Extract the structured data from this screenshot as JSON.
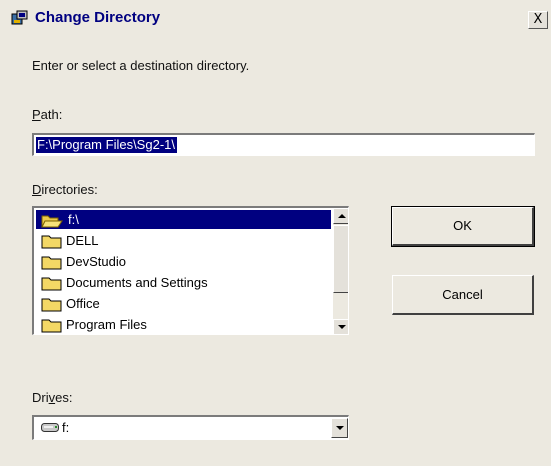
{
  "dialog": {
    "title": "Change Directory",
    "close_label": "X",
    "instruction": "Enter or select a destination directory.",
    "path_label": {
      "prefix": "",
      "accel": "P",
      "rest": "ath:"
    },
    "path_value": "F:\\Program Files\\Sg2-1\\",
    "directories_label": {
      "prefix": "",
      "accel": "D",
      "rest": "irectories:"
    },
    "directories": [
      {
        "label": "f:\\",
        "icon": "open-folder-icon",
        "selected": true
      },
      {
        "label": "DELL",
        "icon": "folder-icon"
      },
      {
        "label": "DevStudio",
        "icon": "folder-icon"
      },
      {
        "label": "Documents and Settings",
        "icon": "folder-icon"
      },
      {
        "label": "Office",
        "icon": "folder-icon"
      },
      {
        "label": "Program Files",
        "icon": "folder-icon"
      }
    ],
    "ok_label": "OK",
    "cancel_label": "Cancel",
    "drives_label": {
      "prefix": "Dri",
      "accel": "v",
      "rest": "es:"
    },
    "drive_value": "f:",
    "colors": {
      "dialog_bg": "#ece9e0",
      "title_text": "#000080",
      "selection": "#000080"
    }
  }
}
